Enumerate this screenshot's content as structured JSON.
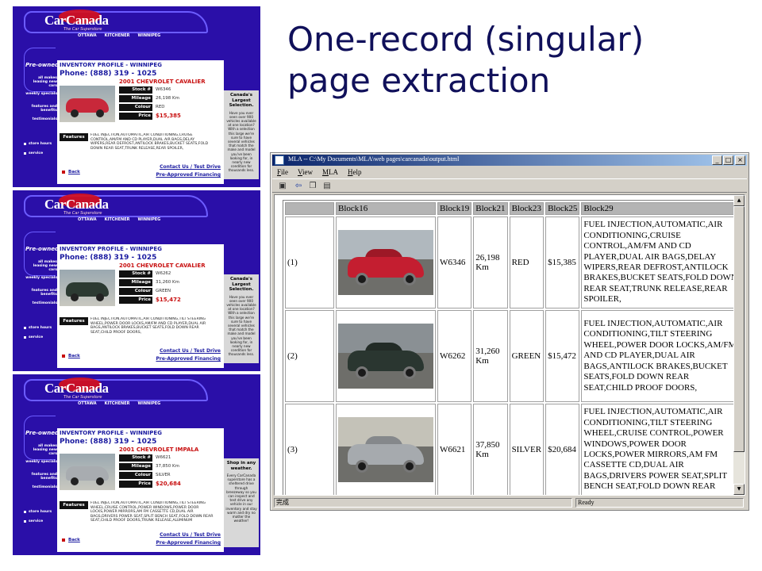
{
  "slide": {
    "title_line1": "One-record (singular)",
    "title_line2": "page extraction"
  },
  "carcanada": {
    "logo": "CarCanada",
    "tagline": "The Car Superstore",
    "cities": [
      "OTTAWA",
      "KITCHENER",
      "WINNIPEG"
    ],
    "sidebar": {
      "pre_owned": "Pre-owned",
      "items": [
        "all makes leasing new cars",
        "weekly specials",
        "features and benefits",
        "testimonials"
      ],
      "footer": [
        "store hours",
        "service"
      ]
    },
    "inventory_title": "INVENTORY PROFILE - WINNIPEG",
    "phone": "Phone: (888) 319 - 1025",
    "labels": {
      "stock": "Stock #",
      "mileage": "Mileage",
      "colour": "Colour",
      "price": "Price",
      "features": "Features"
    },
    "back": "Back",
    "contact": "Contact Us / Test Drive",
    "financing": "Pre-Approved Financing",
    "records": [
      {
        "car_name": "2001 CHEVROLET CAVALIER",
        "stock": "W6346",
        "mileage": "26,198 Km",
        "colour": "RED",
        "price": "$15,385",
        "car_color": "#c8283a",
        "features": "FUEL INJECTION,AUTOMATIC,AIR CONDITIONING,CRUISE CONTROL,AM/FM AND CD PLAYER,DUAL AIR BAGS,DELAY WIPERS,REAR DEFROST,ANTILOCK BRAKES,BUCKET SEATS,FOLD DOWN REAR SEAT,TRUNK RELEASE,REAR SPOILER,",
        "ad_title": "Canada's Largest Selection.",
        "ad_body": "Have you ever seen over 900 vehicles available at one location? With a selection this large we're sure to have several vehicles that match the make and model you've been looking for, in nearly new condition for thousands less."
      },
      {
        "car_name": "2001 CHEVROLET CAVALIER",
        "stock": "W6262",
        "mileage": "31,260 Km",
        "colour": "GREEN",
        "price": "$15,472",
        "car_color": "#2c3a32",
        "features": "FUEL INJECTION,AUTOMATIC,AIR CONDITIONING,TILT STEERING WHEEL,POWER DOOR LOCKS,AM/FM AND CD PLAYER,DUAL AIR BAGS,ANTILOCK BRAKES,BUCKET SEATS,FOLD DOWN REAR SEAT,CHILD PROOF DOORS,",
        "ad_title": "Canada's Largest Selection.",
        "ad_body": "Have you ever seen over 900 vehicles available at one location? With a selection this large we're sure to have several vehicles that match the make and model you've been looking for, in nearly new condition for thousands less."
      },
      {
        "car_name": "2001 CHEVROLET IMPALA",
        "stock": "W6621",
        "mileage": "37,850 Km",
        "colour": "SILVER",
        "price": "$20,684",
        "car_color": "#a8acb0",
        "features": "FUEL INJECTION,AUTOMATIC,AIR CONDITIONING,TILT STEERING WHEEL,CRUISE CONTROL,POWER WINDOWS,POWER DOOR LOCKS,POWER MIRRORS,AM FM CASSETTE CD,DUAL AIR BAGS,DRIVERS POWER SEAT,SPLIT BENCH SEAT,FOLD DOWN REAR SEAT,CHILD PROOF DOORS,TRUNK RELEASE,ALUMINUM",
        "ad_title": "Shop in any weather.",
        "ad_body": "Every CarCanada superstore has a sheltered drive through breezeway so you can inspect and test drive any vehicle in our inventory and stay warm and dry no matter the weather!"
      }
    ]
  },
  "mla": {
    "window_title": "MLA -- C:\\My Documents\\MLA\\web pages\\carcanada\\output.html",
    "menu": [
      "File",
      "View",
      "MLA",
      "Help"
    ],
    "headers": [
      "",
      "Block16",
      "Block19",
      "Block21",
      "Block23",
      "Block25",
      "Block29"
    ],
    "rows": [
      {
        "idx": "(1)",
        "b19": "W6346",
        "b21": "26,198 Km",
        "b23": "RED",
        "b25": "$15,385",
        "b29": "FUEL INJECTION,AUTOMATIC,AIR CONDITIONING,CRUISE CONTROL,AM/FM AND CD PLAYER,DUAL AIR BAGS,DELAY WIPERS,REAR DEFROST,ANTILOCK BRAKES,BUCKET SEATS,FOLD DOWN REAR SEAT,TRUNK RELEASE,REAR SPOILER,",
        "car_color": "#c41e30",
        "bg": "#b0b8be"
      },
      {
        "idx": "(2)",
        "b19": "W6262",
        "b21": "31,260 Km",
        "b23": "GREEN",
        "b25": "$15,472",
        "b29": "FUEL INJECTION,AUTOMATIC,AIR CONDITIONING,TILT STEERING WHEEL,POWER DOOR LOCKS,AM/FM AND CD PLAYER,DUAL AIR BAGS,ANTILOCK BRAKES,BUCKET SEATS,FOLD DOWN REAR SEAT,CHILD PROOF DOORS,",
        "car_color": "#2a3630",
        "bg": "#8a9094"
      },
      {
        "idx": "(3)",
        "b19": "W6621",
        "b21": "37,850 Km",
        "b23": "SILVER",
        "b25": "$20,684",
        "b29": "FUEL INJECTION,AUTOMATIC,AIR CONDITIONING,TILT STEERING WHEEL,CRUISE CONTROL,POWER WINDOWS,POWER DOOR LOCKS,POWER MIRRORS,AM FM CASSETTE CD,DUAL AIR BAGS,DRIVERS POWER SEAT,SPLIT BENCH SEAT,FOLD DOWN REAR",
        "car_color": "#a6aaae",
        "bg": "#c4c2b8"
      }
    ],
    "status_left": "完成",
    "status_right": "Ready"
  }
}
